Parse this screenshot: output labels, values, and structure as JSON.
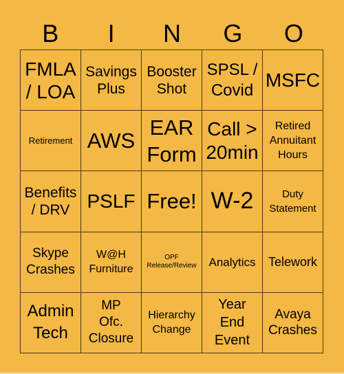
{
  "card": {
    "background_color": "#F4B844",
    "header_letters": [
      "B",
      "I",
      "N",
      "G",
      "O"
    ],
    "rows": [
      [
        "FMLA\n/ LOA",
        "Savings\nPlus",
        "Booster\nShot",
        "SPSL /\nCovid",
        "MSFC"
      ],
      [
        "Retirement",
        "AWS",
        "EAR\nForm",
        "Call >\n20min",
        "Retired\nAnnuitant\nHours"
      ],
      [
        "Benefits\n/ DRV",
        "PSLF",
        "Free!",
        "W-2",
        "Duty\nStatement"
      ],
      [
        "Skype\nCrashes",
        "W@H\nFurniture",
        "OPF\nRelease/Review",
        "Analytics",
        "Telework"
      ],
      [
        "Admin\nTech",
        "MP\nOfc.\nClosure",
        "Hierarchy\nChange",
        "Year\nEnd\nEvent",
        "Avaya\nCrashes"
      ]
    ]
  }
}
